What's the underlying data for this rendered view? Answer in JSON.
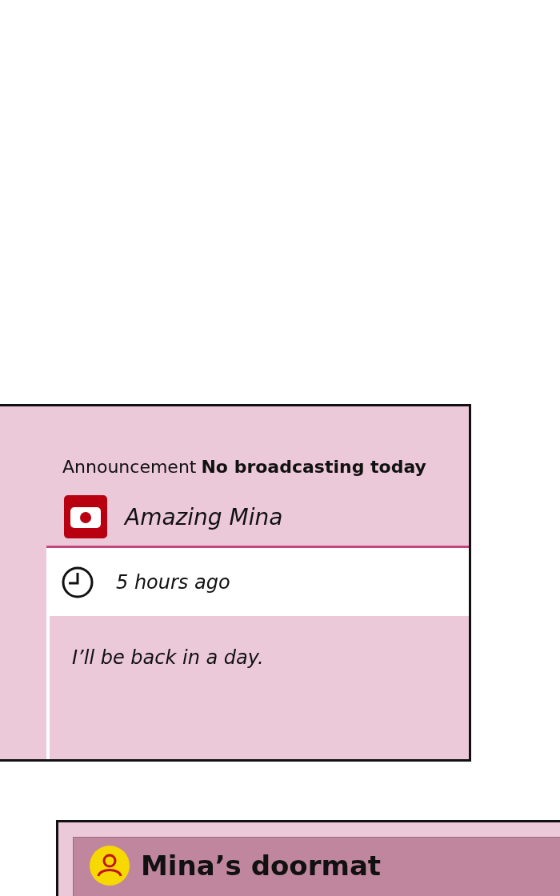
{
  "post": {
    "label": "Announcement",
    "title": "No broadcasting today",
    "channel": "Amazing Mina",
    "time": "5 hours ago",
    "body": "I’ll be back in a day."
  },
  "profile": {
    "name": "Mina’s doormat"
  }
}
